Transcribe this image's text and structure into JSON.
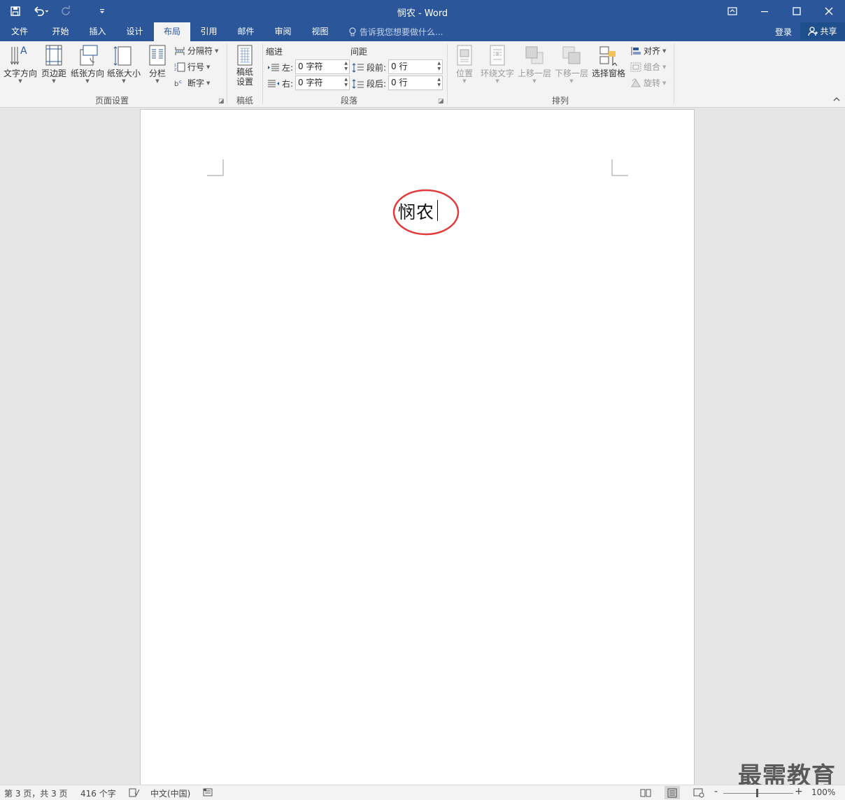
{
  "window": {
    "title": "悯农 - Word"
  },
  "menu_tabs": [
    {
      "label": "文件"
    },
    {
      "label": "开始"
    },
    {
      "label": "插入"
    },
    {
      "label": "设计"
    },
    {
      "label": "布局",
      "active": true
    },
    {
      "label": "引用"
    },
    {
      "label": "邮件"
    },
    {
      "label": "审阅"
    },
    {
      "label": "视图"
    }
  ],
  "tell_me": {
    "placeholder": "告诉我您想要做什么..."
  },
  "account": {
    "login": "登录",
    "share": "共享"
  },
  "ribbon": {
    "page_setup": {
      "label": "页面设置",
      "text_direction": "文字方向",
      "margins": "页边距",
      "orientation": "纸张方向",
      "size": "纸张大小",
      "columns": "分栏",
      "breaks": "分隔符",
      "line_numbers": "行号",
      "hyphenation": "断字"
    },
    "draft_paper": {
      "label": "稿纸",
      "setup_line1": "稿纸",
      "setup_line2": "设置"
    },
    "paragraph": {
      "label": "段落",
      "indent_header": "缩进",
      "spacing_header": "间距",
      "indent_left_label": "左:",
      "indent_left_value": "0 字符",
      "indent_right_label": "右:",
      "indent_right_value": "0 字符",
      "spacing_before_label": "段前:",
      "spacing_before_value": "0 行",
      "spacing_after_label": "段后:",
      "spacing_after_value": "0 行"
    },
    "arrange": {
      "label": "排列",
      "position": "位置",
      "wrap_text": "环绕文字",
      "bring_forward": "上移一层",
      "send_backward": "下移一层",
      "selection_pane": "选择窗格",
      "align": "对齐",
      "group": "组合",
      "rotate": "旋转"
    }
  },
  "document": {
    "text": "悯农"
  },
  "watermark": "最需教育",
  "status": {
    "page": "第 3 页，共 3 页",
    "words": "416 个字",
    "language": "中文(中国)",
    "zoom": "100%"
  },
  "colors": {
    "brand": "#2b579a",
    "annotation_ellipse": "#e03a3a"
  }
}
